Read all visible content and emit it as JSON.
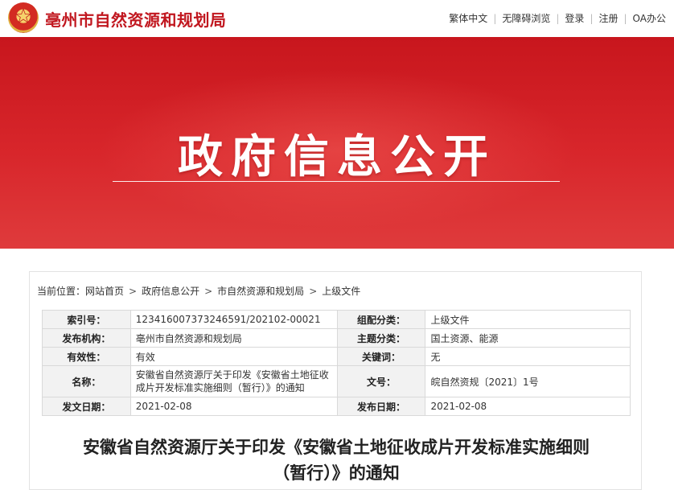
{
  "header": {
    "site_title": "亳州市自然资源和规划局",
    "links": [
      "繁体中文",
      "无障碍浏览",
      "登录",
      "注册",
      "OA办公"
    ],
    "emblem_icon": "national-emblem-icon"
  },
  "banner": {
    "title": "政府信息公开"
  },
  "breadcrumb": {
    "prefix": "当前位置：",
    "items": [
      "网站首页",
      "政府信息公开",
      "市自然资源和规划局",
      "上级文件"
    ],
    "separator": ">"
  },
  "meta_table": {
    "rows": [
      {
        "label1": "索引号：",
        "value1": "123416007373246591/202102-00021",
        "label2": "组配分类：",
        "value2": "上级文件"
      },
      {
        "label1": "发布机构：",
        "value1": "亳州市自然资源和规划局",
        "label2": "主题分类：",
        "value2": "国土资源、能源"
      },
      {
        "label1": "有效性：",
        "value1": "有效",
        "label2": "关键词：",
        "value2": "无"
      },
      {
        "label1": "名称：",
        "value1": "安徽省自然资源厅关于印发《安徽省土地征收成片开发标准实施细则（暂行）》的通知",
        "label2": "文号：",
        "value2": "皖自然资规〔2021〕1号"
      },
      {
        "label1": "发文日期：",
        "value1": "2021-02-08",
        "label2": "发布日期：",
        "value2": "2021-02-08"
      }
    ]
  },
  "document": {
    "title_line1": "安徽省自然资源厅关于印发《安徽省土地征收成片开发标准实施细则",
    "title_line2": "（暂行）》的通知"
  },
  "colors": {
    "brand_red": "#c1171f",
    "banner_red": "#d8262b"
  }
}
